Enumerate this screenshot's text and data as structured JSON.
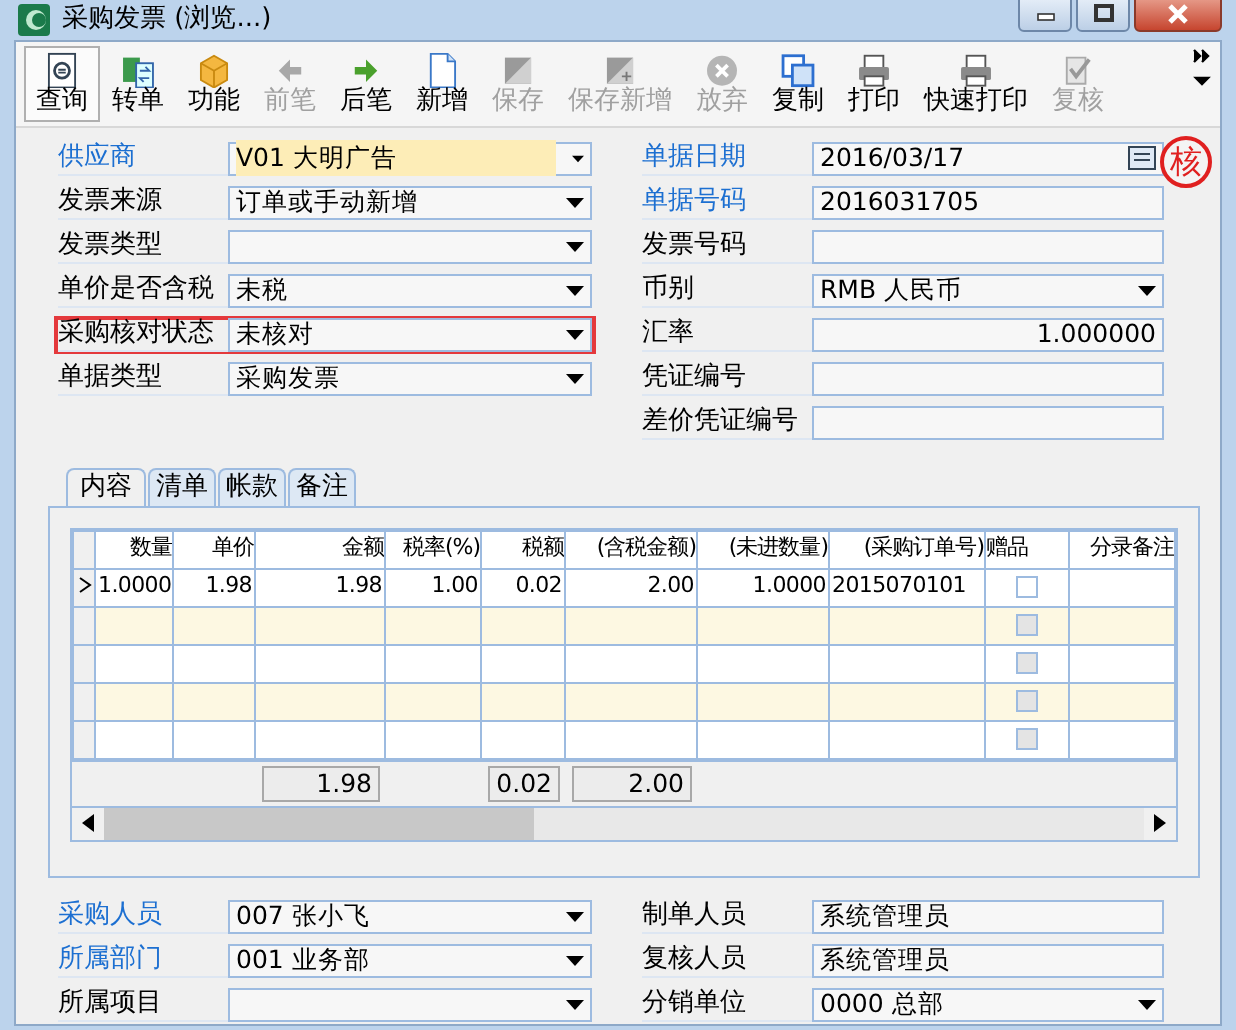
{
  "window": {
    "title": "采购发票 (浏览...)"
  },
  "toolbar": [
    {
      "label": "查询",
      "kind": "query",
      "disabled": false,
      "selected": true
    },
    {
      "label": "转单",
      "kind": "transfer",
      "disabled": false,
      "selected": false
    },
    {
      "label": "功能",
      "kind": "box",
      "disabled": false,
      "selected": false
    },
    {
      "label": "前笔",
      "kind": "prev",
      "disabled": true,
      "selected": false
    },
    {
      "label": "后笔",
      "kind": "next",
      "disabled": false,
      "selected": false
    },
    {
      "label": "新增",
      "kind": "new",
      "disabled": false,
      "selected": false
    },
    {
      "label": "保存",
      "kind": "save",
      "disabled": true,
      "selected": false
    },
    {
      "label": "保存新增",
      "kind": "savenew",
      "disabled": true,
      "selected": false
    },
    {
      "label": "放弃",
      "kind": "cancel",
      "disabled": true,
      "selected": false
    },
    {
      "label": "复制",
      "kind": "copy",
      "disabled": false,
      "selected": false
    },
    {
      "label": "打印",
      "kind": "print",
      "disabled": false,
      "selected": false
    },
    {
      "label": "快速打印",
      "kind": "print",
      "disabled": false,
      "selected": false
    },
    {
      "label": "复核",
      "kind": "review",
      "disabled": true,
      "selected": false
    }
  ],
  "form_left": [
    {
      "label": "供应商",
      "value": "V01 大明广告",
      "kind": "select",
      "required": true,
      "highlighted": false,
      "focused": true
    },
    {
      "label": "发票来源",
      "value": "订单或手动新增",
      "kind": "select",
      "required": false,
      "highlighted": false,
      "focused": false
    },
    {
      "label": "发票类型",
      "kind": "select",
      "required": false,
      "highlighted": false,
      "focused": false
    },
    {
      "label": "单价是否含税",
      "value": "未税",
      "kind": "select",
      "required": false,
      "highlighted": false,
      "focused": false
    },
    {
      "label": "采购核对状态",
      "value": "未核对",
      "kind": "select",
      "required": false,
      "highlighted": true,
      "focused": false
    },
    {
      "label": "单据类型",
      "value": "采购发票",
      "kind": "select",
      "required": false,
      "highlighted": false,
      "focused": false
    }
  ],
  "form_right": [
    {
      "label": "单据日期",
      "value": "2016/03/17",
      "kind": "date",
      "required": true
    },
    {
      "label": "单据号码",
      "value": "2016031705",
      "kind": "text",
      "required": true
    },
    {
      "label": "发票号码",
      "kind": "text",
      "required": false
    },
    {
      "label": "币别",
      "value": "RMB 人民币",
      "kind": "select",
      "required": false
    },
    {
      "label": "汇率",
      "value": "1.000000",
      "kind": "number",
      "required": false
    },
    {
      "label": "凭证编号",
      "kind": "text",
      "required": false
    },
    {
      "label": "差价凭证编号",
      "kind": "text",
      "required": false
    }
  ],
  "stamp": {
    "text": "核"
  },
  "tabs": [
    {
      "label": "内容",
      "selected": true
    },
    {
      "label": "清单",
      "selected": false
    },
    {
      "label": "帐款",
      "selected": false
    },
    {
      "label": "备注",
      "selected": false
    }
  ],
  "grid": {
    "columns": [
      {
        "label": "数量"
      },
      {
        "label": "单价"
      },
      {
        "label": "金额",
        "total": "1.98"
      },
      {
        "label": "税率(%)"
      },
      {
        "label": "税额",
        "total": "0.02"
      },
      {
        "label": "(含税金额)",
        "total": "2.00"
      },
      {
        "label": "(未进数量)"
      },
      {
        "label": "(采购订单号)"
      },
      {
        "label": "赠品"
      },
      {
        "label": "分录备注"
      }
    ],
    "rows": [
      {
        "selected": true,
        "cells": [
          "1.0000",
          "1.98",
          "1.98",
          "1.00",
          "0.02",
          "2.00",
          "1.0000",
          "2015070101"
        ],
        "gift": false,
        "disabled": false
      },
      {
        "selected": false,
        "gift": false,
        "disabled": true
      },
      {
        "selected": false,
        "gift": false,
        "disabled": true
      },
      {
        "selected": false,
        "gift": false,
        "disabled": true
      },
      {
        "selected": false,
        "gift": false,
        "disabled": true
      }
    ]
  },
  "bottom_left": [
    {
      "label": "采购人员",
      "value": "007 张小飞",
      "kind": "select",
      "required": true
    },
    {
      "label": "所属部门",
      "value": "001 业务部",
      "kind": "select",
      "required": true
    },
    {
      "label": "所属项目",
      "kind": "select",
      "required": false
    }
  ],
  "bottom_right": [
    {
      "label": "制单人员",
      "value": "系统管理员",
      "kind": "text",
      "required": false
    },
    {
      "label": "复核人员",
      "value": "系统管理员",
      "kind": "text",
      "required": false
    },
    {
      "label": "分销单位",
      "value": "0000 总部",
      "kind": "select",
      "required": false
    }
  ]
}
